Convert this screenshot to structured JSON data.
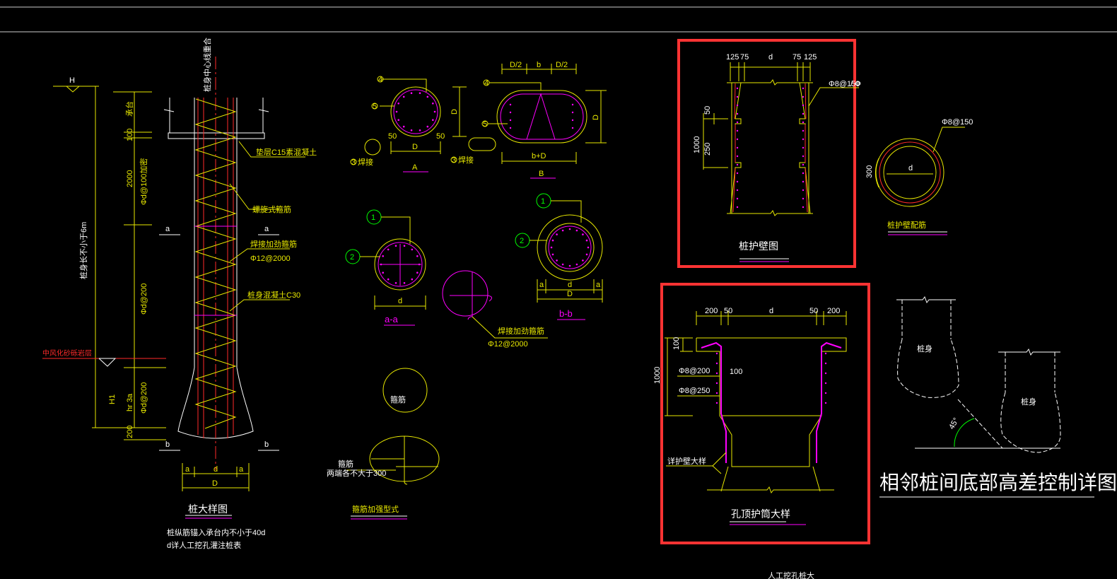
{
  "colors": {
    "background": "#000000",
    "line_yellow": "#e8e800",
    "line_white": "#ffffff",
    "line_red": "#ff2a2a",
    "line_magenta": "#ff00ff",
    "line_green": "#00ff00",
    "highlight_box": "#ff3333"
  },
  "main_detail": {
    "title": "桩大样图",
    "note_1": "桩纵筋锚入承台内不小于40d",
    "note_2": "d详人工挖孔灌注桩表",
    "label_h": "H",
    "label_length": "桩身长不小于6m",
    "label_center": "桩身中心线重合",
    "label_cap": "承台",
    "label_c15": "垫层C15素混凝土",
    "label_spiral": "螺旋式箍筋",
    "label_weld": "焊接加劲箍筋",
    "label_weld_spec": "Φ12@2000",
    "label_concrete": "桩身混凝土C30",
    "label_layer": "中风化砂砾岩层",
    "dim_100": "100",
    "dim_2000": "2000",
    "dim_a100": "Φd@100加密",
    "dim_a200": "Φd@200",
    "dim_a200b": "Φd@200",
    "dim_hr": "hr 3a",
    "dim_200": "200",
    "label_h1": "H1",
    "sec_a_left": "a",
    "sec_a_right": "a",
    "sec_b_left": "b",
    "sec_b_right": "b",
    "dim_a_l": "a",
    "dim_d": "d",
    "dim_a_r": "a",
    "dim_D": "D"
  },
  "sections": {
    "A_label": "A",
    "B_label": "B",
    "aa_label": "a-a",
    "bb_label": "b-b",
    "n1": "1",
    "n2": "2",
    "n3": "3",
    "n4": "4",
    "n5": "5",
    "dim_50a": "50",
    "dim_50b": "50",
    "dim_D": "D",
    "dim_D2a": "D/2",
    "dim_b": "b",
    "dim_D2b": "D/2",
    "dim_bD": "b+D",
    "dim_d_aa": "d",
    "dim_a1": "a",
    "dim_d_bb": "d",
    "dim_D_bb": "D",
    "dim_a2": "a",
    "lbl_weld1": "焊接",
    "lbl_weld2": "焊接",
    "weld_label": "焊接加劲箍筋",
    "weld_spec": "Φ12@2000",
    "stirrup_title": "箍筋加强型式",
    "stirrup_lbl": "箍筋",
    "stirrup_lbl2": "箍筋",
    "stirrup_lap": "两端各不大于300"
  },
  "wall_detail": {
    "title": "桩护壁图",
    "dim_125a": "125",
    "dim_75a": "75",
    "dim_d": "d",
    "dim_75b": "75",
    "dim_125b": "125",
    "dim_50": "50",
    "dim_1000": "1000",
    "dim_250": "250",
    "rebar": "Φ8@150",
    "rebar_suffix": "/ Φ"
  },
  "wall_rebar": {
    "title": "桩护壁配筋",
    "rebar": "Φ8@150",
    "dim_d": "d",
    "dim_300": "300"
  },
  "collar_detail": {
    "title": "孔顶护筒大样",
    "dim_200a": "200",
    "dim_50a": "50",
    "dim_d": "d",
    "dim_50b": "50",
    "dim_200b": "200",
    "dim_100": "100",
    "dim_1000": "1000",
    "rebar1": "Φ8@200",
    "rebar2": "Φ8@250",
    "dim_100b": "100",
    "wall_label": "详护壁大样"
  },
  "adjacent_detail": {
    "title": "相邻桩间底部高差控制详图",
    "pile1": "桩身",
    "pile2": "桩身",
    "angle": "45°"
  },
  "bottom_text": "人工挖孔桩大"
}
